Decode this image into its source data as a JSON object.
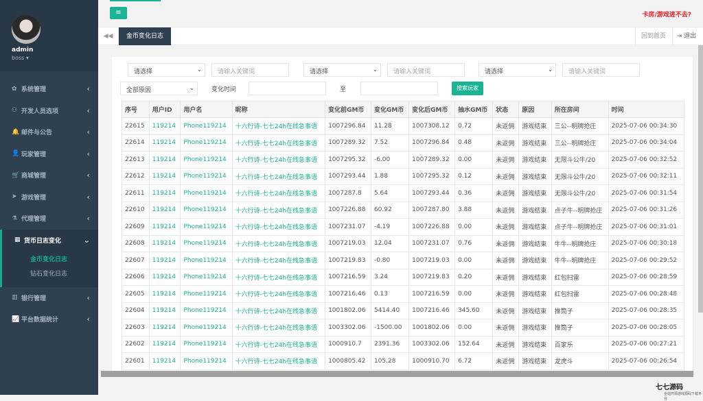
{
  "user": {
    "name": "admin",
    "role": "boss"
  },
  "sidebar": {
    "items": [
      {
        "label": "系统管理",
        "icon": "gears-icon",
        "glyph": "✿"
      },
      {
        "label": "开发人员选项",
        "icon": "gamepad-icon",
        "glyph": "⚇"
      },
      {
        "label": "邮件与公告",
        "icon": "bell-icon",
        "glyph": "🔔"
      },
      {
        "label": "玩家管理",
        "icon": "user-icon",
        "glyph": "👤"
      },
      {
        "label": "商城管理",
        "icon": "cart-icon",
        "glyph": "🛒"
      },
      {
        "label": "游戏管理",
        "icon": "rocket-icon",
        "glyph": "➤"
      },
      {
        "label": "代理管理",
        "icon": "flask-icon",
        "glyph": "⚗"
      }
    ],
    "active": {
      "label": "货币日志变化",
      "icon": "calendar-icon",
      "glyph": "▦"
    },
    "sub_items": [
      "金币变化日志",
      "钻石变化日志"
    ],
    "bottom_items": [
      {
        "label": "银行管理",
        "icon": "bank-icon",
        "glyph": "▥"
      },
      {
        "label": "平台数据统计",
        "icon": "line-chart-icon",
        "glyph": "📈"
      }
    ]
  },
  "topbar": {
    "menu_glyph": "≡",
    "alert": "卡房/游戏进不去?"
  },
  "tabs": {
    "back_glyph": "◀◀",
    "active": "金币变化日志",
    "home": "回到首页",
    "logout": "退出"
  },
  "filters": {
    "select_placeholder": "请选择",
    "keyword_placeholder": "请输入关键词",
    "reason_select": "全部原因",
    "time_label": "变化时间",
    "to_label": "至",
    "search_button": "搜索玩家"
  },
  "table": {
    "headers": [
      "序号",
      "用户ID",
      "用户名",
      "昵称",
      "变化前GM币",
      "变化GM币",
      "变化后GM币",
      "抽水GM币",
      "状态",
      "原因",
      "所在房间",
      "时间"
    ],
    "rows": [
      [
        "22615",
        "119214",
        "Phone119214",
        "十六行诗-七七24h在线急事语",
        "1007296.84",
        "11.28",
        "1007308.12",
        "0.72",
        "未返佣",
        "游戏结束",
        "三公--明牌抢庄",
        "2025-07-06 00:34:30"
      ],
      [
        "22614",
        "119214",
        "Phone119214",
        "十六行诗-七七24h在线急事语",
        "1007289.32",
        "7.52",
        "1007296.84",
        "0.48",
        "未返佣",
        "游戏结束",
        "三公--明牌抢庄",
        "2025-07-06 00:34:04"
      ],
      [
        "22613",
        "119214",
        "Phone119214",
        "十六行诗-七七24h在线急事语",
        "1007295.32",
        "-6.00",
        "1007289.32",
        "0.00",
        "未返佣",
        "游戏结束",
        "无限斗公牛/20",
        "2025-07-06 00:32:52"
      ],
      [
        "22612",
        "119214",
        "Phone119214",
        "十六行诗-七七24h在线急事语",
        "1007293.44",
        "1.88",
        "1007295.32",
        "0.12",
        "未返佣",
        "游戏结束",
        "无限斗公牛/20",
        "2025-07-06 00:32:11"
      ],
      [
        "22611",
        "119214",
        "Phone119214",
        "十六行诗-七七24h在线急事语",
        "1007287.8",
        "5.64",
        "1007293.44",
        "0.36",
        "未返佣",
        "游戏结束",
        "无限斗公牛/20",
        "2025-07-06 00:31:54"
      ],
      [
        "22610",
        "119214",
        "Phone119214",
        "十六行诗-七七24h在线急事语",
        "1007226.88",
        "60.92",
        "1007287.80",
        "3.88",
        "未返佣",
        "游戏结束",
        "点子牛--明牌抢庄",
        "2025-07-06 00:31:26"
      ],
      [
        "22609",
        "119214",
        "Phone119214",
        "十六行诗-七七24h在线急事语",
        "1007231.07",
        "-4.19",
        "1007226.88",
        "0.00",
        "未返佣",
        "游戏结束",
        "点子牛--明牌抢庄",
        "2025-07-06 00:31:01"
      ],
      [
        "22608",
        "119214",
        "Phone119214",
        "十六行诗-七七24h在线急事语",
        "1007219.03",
        "12.04",
        "1007231.07",
        "0.76",
        "未返佣",
        "游戏结束",
        "牛牛--明牌抢庄",
        "2025-07-06 00:30:18"
      ],
      [
        "22607",
        "119214",
        "Phone119214",
        "十六行诗-七七24h在线急事语",
        "1007219.83",
        "-0.80",
        "1007219.03",
        "0.00",
        "未返佣",
        "游戏结束",
        "牛牛--明牌抢庄",
        "2025-07-06 00:29:52"
      ],
      [
        "22606",
        "119214",
        "Phone119214",
        "十六行诗-七七24h在线急事语",
        "1007216.59",
        "3.24",
        "1007219.83",
        "0.20",
        "未返佣",
        "游戏结束",
        "红包扫雷",
        "2025-07-06 00:28:59"
      ],
      [
        "22605",
        "119214",
        "Phone119214",
        "十六行诗-七七24h在线急事语",
        "1007216.46",
        "0.13",
        "1007216.59",
        "0.00",
        "未返佣",
        "游戏结束",
        "红包扫雷",
        "2025-07-06 00:28:48"
      ],
      [
        "22604",
        "119214",
        "Phone119214",
        "十六行诗-七七24h在线急事语",
        "1001802.06",
        "5414.40",
        "1007216.46",
        "345.60",
        "未返佣",
        "游戏结束",
        "推筒子",
        "2025-07-06 00:28:35"
      ],
      [
        "22603",
        "119214",
        "Phone119214",
        "十六行诗-七七24h在线急事语",
        "1003302.06",
        "-1500.00",
        "1001802.06",
        "0.00",
        "未返佣",
        "游戏结束",
        "推筒子",
        "2025-07-06 00:28:05"
      ],
      [
        "22602",
        "119214",
        "Phone119214",
        "十六行诗-七七24h在线急事语",
        "1000910.7",
        "2391.36",
        "1003302.06",
        "152.64",
        "未返佣",
        "游戏结束",
        "百家乐",
        "2025-07-06 00:27:21"
      ],
      [
        "22601",
        "119214",
        "Phone119214",
        "十六行诗-七七24h在线急事语",
        "1000805.42",
        "105.28",
        "1000910.70",
        "6.72",
        "未返佣",
        "游戏结束",
        "龙虎斗",
        "2025-07-06 00:26:54"
      ]
    ]
  },
  "watermark": {
    "brand": "七七源码",
    "tagline": "全站开源游戏源码下载平台"
  },
  "colors": {
    "accent": "#1ab394",
    "sidebar": "#2f4050",
    "alert": "#ed1c24"
  }
}
